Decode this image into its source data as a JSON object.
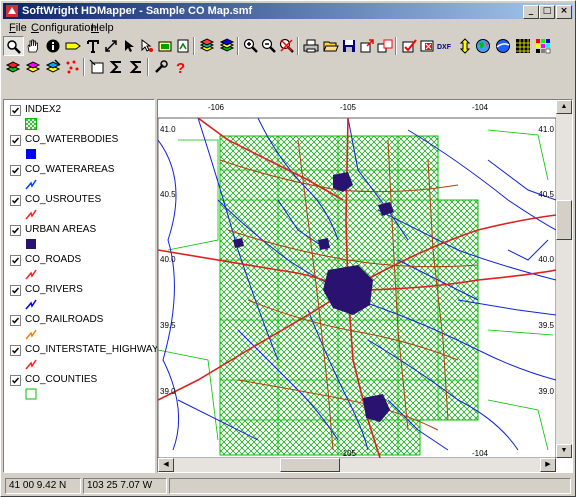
{
  "window": {
    "title": "SoftWright HDMapper - Sample CO Map.smf"
  },
  "menu": [
    {
      "label": "File",
      "key": "F",
      "rest": "ile"
    },
    {
      "label": "Configuration",
      "key": "C",
      "rest": "onfiguration"
    },
    {
      "label": "Help",
      "key": "H",
      "rest": "elp"
    }
  ],
  "toolbar1": [
    "zoom-select-icon",
    "pan-hand-icon",
    "info-icon",
    "label-icon",
    "text-tool-icon",
    "resize-icon",
    "pointer-icon",
    "edit-pointer-icon",
    "rectangle-icon",
    "page-icon",
    "layers-icon",
    "layers-color-icon",
    "zoom-in-icon",
    "zoom-out-icon",
    "zoom-cancel-icon",
    "print-icon",
    "open-folder-icon",
    "save-icon",
    "export-icon",
    "copy-layers-icon",
    "checkbox-icon",
    "close-red-icon",
    "dxf-icon",
    "arrows-icon",
    "globe-icon",
    "satellite-icon",
    "grid-icon",
    "palette-icon"
  ],
  "toolbar2": [
    "layer-add-icon",
    "layer-stack-icon",
    "layer-edit-icon",
    "points-icon",
    "select-box-icon",
    "sigma-icon",
    "sigma-sum-icon",
    "tools-icon",
    "help-question-icon"
  ],
  "dxf_label": "DXF",
  "legend": [
    {
      "name": "INDEX2",
      "symbol": "hatch",
      "color": "#00c000"
    },
    {
      "name": "CO_WATERBODIES",
      "symbol": "fill",
      "color": "#0000ff"
    },
    {
      "name": "CO_WATERAREAS",
      "symbol": "line",
      "color": "#0040ff"
    },
    {
      "name": "CO_USROUTES",
      "symbol": "line",
      "color": "#ff2020"
    },
    {
      "name": "URBAN AREAS",
      "symbol": "fill",
      "color": "#2a1370"
    },
    {
      "name": "CO_ROADS",
      "symbol": "line",
      "color": "#ff2020"
    },
    {
      "name": "CO_RIVERS",
      "symbol": "line",
      "color": "#0000ff"
    },
    {
      "name": "CO_RAILROADS",
      "symbol": "line",
      "color": "#ff8000"
    },
    {
      "name": "CO_INTERSTATE_HIGHWAY",
      "symbol": "line",
      "color": "#ff2020"
    },
    {
      "name": "CO_COUNTIES",
      "symbol": "box",
      "color": "#00c000"
    }
  ],
  "map": {
    "lon_top": [
      "-106",
      "-105",
      "-104"
    ],
    "lon_bottom": [
      "-105",
      "-104"
    ],
    "lat_left": [
      "41.0",
      "40.5",
      "40.0",
      "39.5",
      "39.0"
    ],
    "lat_right": [
      "41.0",
      "40.5",
      "40.0",
      "39.5",
      "39.0"
    ]
  },
  "status": {
    "lat": "41 00 9.42 N",
    "lon": "103 25 7.07 W"
  }
}
